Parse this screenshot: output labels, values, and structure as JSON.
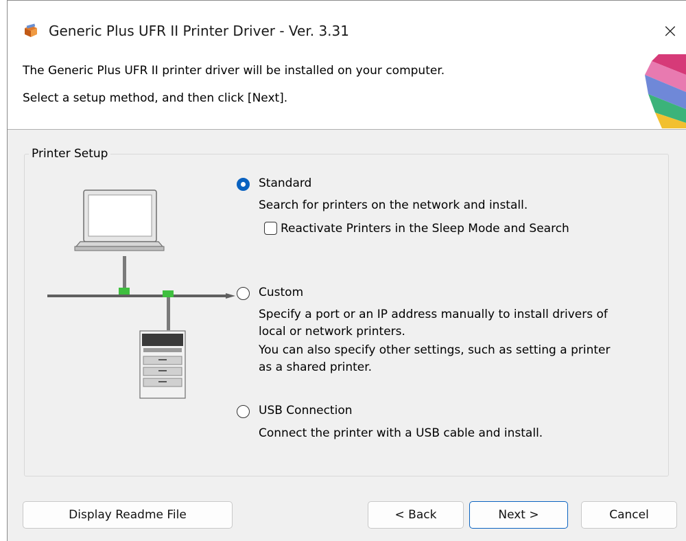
{
  "window": {
    "title": "Generic Plus UFR II Printer Driver - Ver. 3.31",
    "close_glyph": "×"
  },
  "header": {
    "line1": "The Generic Plus UFR II printer driver will be installed on your computer.",
    "line2": "Select a setup method, and then click [Next]."
  },
  "setup_group": {
    "label": "Printer Setup",
    "options": [
      {
        "label": "Standard",
        "selected": true,
        "description": [
          "Search for printers on the network and install."
        ],
        "checkbox": {
          "label": "Reactivate Printers in the Sleep Mode and Search",
          "checked": false
        }
      },
      {
        "label": "Custom",
        "selected": false,
        "description": [
          "Specify a port or an IP address manually to install drivers of",
          "local or network printers.",
          "You can also specify other settings, such as setting a printer",
          "as a shared printer."
        ]
      },
      {
        "label": "USB Connection",
        "selected": false,
        "description": [
          "Connect the printer with a USB cable and install."
        ]
      }
    ]
  },
  "buttons": {
    "readme": "Display Readme File",
    "back": "< Back",
    "next": "Next >",
    "cancel": "Cancel"
  },
  "colors": {
    "accent": "#0a62c0",
    "network_connector": "#3fbf3f"
  },
  "icons": {
    "app": "installer-box-icon",
    "close": "close-icon"
  }
}
